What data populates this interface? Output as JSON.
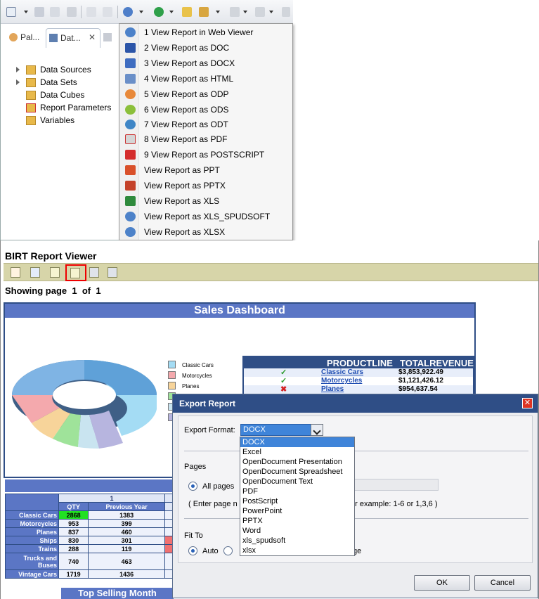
{
  "eclipse": {
    "view_tabs": [
      {
        "label": "Pal..."
      },
      {
        "label": "Dat..."
      }
    ],
    "tree": [
      {
        "label": "Data Sources",
        "expandable": true
      },
      {
        "label": "Data Sets",
        "expandable": true
      },
      {
        "label": "Data Cubes",
        "expandable": false
      },
      {
        "label": "Report Parameters",
        "expandable": false
      },
      {
        "label": "Variables",
        "expandable": false
      }
    ],
    "run_menu": [
      "1 View Report in Web Viewer",
      "2 View Report as DOC",
      "3 View Report as DOCX",
      "4 View Report as HTML",
      "5 View Report as ODP",
      "6 View Report as ODS",
      "7 View Report as ODT",
      "8 View Report as PDF",
      "9 View Report as POSTSCRIPT",
      "View Report as PPT",
      "View Report as PPTX",
      "View Report as XLS",
      "View Report as XLS_SPUDSOFT",
      "View Report as XLSX"
    ]
  },
  "viewer": {
    "title": "BIRT Report Viewer",
    "toolbar_icons": [
      "toc-icon",
      "parameters-icon",
      "export-data-icon",
      "export-report-icon",
      "print-icon",
      "print-server-icon"
    ],
    "nav": {
      "showing": "Showing page",
      "page": "1",
      "of": "of",
      "total": "1"
    }
  },
  "report": {
    "title": "Sales Dashboard",
    "legend": [
      "Classic Cars",
      "Motorcycles",
      "Planes"
    ],
    "productline_table": {
      "headers": [
        "PRODUCTLINE",
        "TOTALREVENUE"
      ],
      "rows": [
        {
          "status": "✓",
          "status_color": "#2a9a2a",
          "product": "Classic Cars",
          "revenue": "$3,853,922.49"
        },
        {
          "status": "✓",
          "status_color": "#2a9a2a",
          "product": "Motorcycles",
          "revenue": "$1,121,426.12"
        },
        {
          "status": "✖",
          "status_color": "#d42020",
          "product": "Planes",
          "revenue": "$954,637.54"
        }
      ]
    },
    "crosstab": {
      "group": "1",
      "col_headers": [
        "QTY",
        "Previous Year"
      ],
      "rows": [
        {
          "label": "Classic Cars",
          "qty": "2868",
          "prev": "1383",
          "highlight": "#22e022"
        },
        {
          "label": "Motorcycles",
          "qty": "953",
          "prev": "399",
          "highlight": ""
        },
        {
          "label": "Planes",
          "qty": "837",
          "prev": "460",
          "highlight": ""
        },
        {
          "label": "Ships",
          "qty": "830",
          "prev": "301",
          "highlight": ""
        },
        {
          "label": "Trains",
          "qty": "288",
          "prev": "119",
          "highlight": ""
        },
        {
          "label": "Trucks and Buses",
          "qty": "740",
          "prev": "463",
          "highlight": ""
        },
        {
          "label": "Vintage Cars",
          "qty": "1719",
          "prev": "1436",
          "highlight": ""
        }
      ],
      "footer": "Top Selling Month"
    }
  },
  "dialog": {
    "title": "Export Report",
    "export_format_label": "Export Format:",
    "selected_format": "DOCX",
    "format_options": [
      "DOCX",
      "Excel",
      "OpenDocument Presentation",
      "OpenDocument Spreadsheet",
      "OpenDocument Text",
      "PDF",
      "PostScript",
      "PowerPoint",
      "PPTX",
      "Word",
      "xls_spudsoft",
      "xlsx"
    ],
    "pages_label": "Pages",
    "all_pages_label": "All pages",
    "page_hint_left": "( Enter page n",
    "page_hint_right": "or example: 1-6 or 1,3,6 )",
    "fit_to_label": "Fit To",
    "auto_label": "Auto",
    "ge_fragment": "ge",
    "ok_label": "OK",
    "cancel_label": "Cancel"
  },
  "colors": {
    "accent": "#2f4e86",
    "header_blue": "#5b76c5",
    "viewer_toolbar": "#d7d5a9"
  }
}
